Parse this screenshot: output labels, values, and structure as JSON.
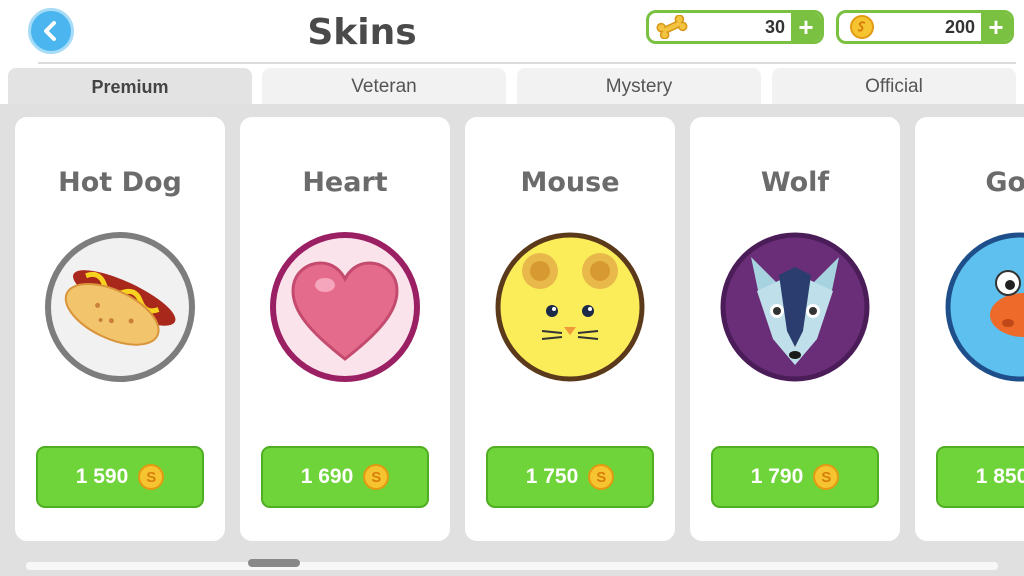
{
  "header": {
    "title": "Skins",
    "back_icon": "chevron-left-icon"
  },
  "currencies": {
    "bones": {
      "icon": "bone-icon",
      "value": "30",
      "add_label": "+"
    },
    "coins": {
      "icon": "coin-icon",
      "value": "200",
      "add_label": "+"
    }
  },
  "tabs": [
    {
      "label": "Premium",
      "active": true
    },
    {
      "label": "Veteran",
      "active": false
    },
    {
      "label": "Mystery",
      "active": false
    },
    {
      "label": "Official",
      "active": false
    }
  ],
  "skins": [
    {
      "name": "Hot Dog",
      "price": "1 590",
      "icon": "hot-dog-icon"
    },
    {
      "name": "Heart",
      "price": "1 690",
      "icon": "heart-icon"
    },
    {
      "name": "Mouse",
      "price": "1 750",
      "icon": "mouse-icon"
    },
    {
      "name": "Wolf",
      "price": "1 790",
      "icon": "wolf-icon"
    },
    {
      "name": "Gold",
      "price": "1 850",
      "icon": "goldfish-icon"
    }
  ],
  "colors": {
    "accent_green": "#6fd43a",
    "back_blue": "#4ab5ee",
    "coin_gold": "#f6c431"
  }
}
